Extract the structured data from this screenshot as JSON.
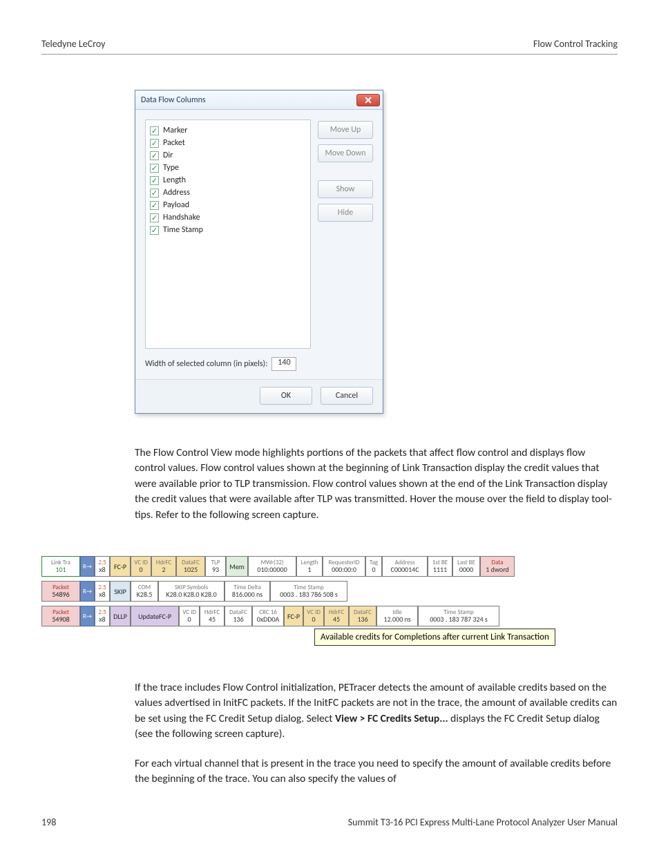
{
  "header": {
    "left": "Teledyne LeCroy",
    "right": "Flow Control Tracking"
  },
  "dialog": {
    "title": "Data Flow Columns",
    "columns": [
      "Marker",
      "Packet",
      "Dir",
      "Type",
      "Length",
      "Address",
      "Payload",
      "Handshake",
      "Time Stamp"
    ],
    "buttons": {
      "moveUp": "Move Up",
      "moveDown": "Move Down",
      "show": "Show",
      "hide": "Hide"
    },
    "widthLabel": "Width of selected column (in pixels):",
    "widthValue": "140",
    "ok": "OK",
    "cancel": "Cancel"
  },
  "para1": "The Flow Control View mode highlights portions of the packets that affect flow control and displays flow control values. Flow control values shown at the beginning of Link Transaction display the credit values that were available prior to TLP transmission. Flow control values shown at the end of the Link Transaction display the credit values that were available after TLP was transmitted. Hover the mouse over the field to display tool-tips. Refer to the following screen capture.",
  "trace": {
    "row1": {
      "a": {
        "top": "Link Tra",
        "bot": "101"
      },
      "dir": "R→",
      "speed": {
        "top": "2.5",
        "bot": "x8"
      },
      "tag": "FC-P",
      "cells": [
        {
          "h": "VC ID",
          "v": "0"
        },
        {
          "h": "HdrFC",
          "v": "2"
        },
        {
          "h": "DataFC",
          "v": "1025"
        },
        {
          "h": "TLP",
          "v": "93"
        }
      ],
      "mem": "Mem",
      "mwr": {
        "h": "MWr(32)",
        "v": "010:00000"
      },
      "len": {
        "h": "Length",
        "v": "1"
      },
      "req": {
        "h": "RequesterID",
        "v": "000:00:0"
      },
      "tag2": {
        "h": "Tag",
        "v": "0"
      },
      "addr": {
        "h": "Address",
        "v": "C000014C"
      },
      "be1": {
        "h": "1st BE",
        "v": "1111"
      },
      "be2": {
        "h": "Last BE",
        "v": "0000"
      },
      "data": {
        "h": "Data",
        "v": "1 dword"
      }
    },
    "row2": {
      "a": {
        "top": "Packet",
        "bot": "54896"
      },
      "dir": "R→",
      "speed": {
        "top": "2.5",
        "bot": "x8"
      },
      "tag": "SKIP",
      "cells": [
        {
          "h": "COM",
          "v": "K28.5"
        },
        {
          "h": "SKIP Symbols",
          "v": "K28.0 K28.0 K28.0"
        },
        {
          "h": "Time Delta",
          "v": "816.000 ns"
        },
        {
          "h": "Time Stamp",
          "v": "0003 . 183 786 508 s"
        }
      ]
    },
    "row3": {
      "a": {
        "top": "Packet",
        "bot": "54908"
      },
      "dir": "R→",
      "speed": {
        "top": "2.5",
        "bot": "x8"
      },
      "tag": "DLLP",
      "upd": "UpdateFC-P",
      "cells": [
        {
          "h": "VC ID",
          "v": "0"
        },
        {
          "h": "HdrFC",
          "v": "45"
        },
        {
          "h": "DataFC",
          "v": "136"
        },
        {
          "h": "CRC 16",
          "v": "0xDD0A"
        }
      ],
      "tag2": "FC-P",
      "cells2": [
        {
          "h": "VC ID",
          "v": "0"
        },
        {
          "h": "HdrFC",
          "v": "45"
        },
        {
          "h": "DataFC",
          "v": "136"
        },
        {
          "h": "Idle",
          "v": "12.000 ns"
        },
        {
          "h": "Time Stamp",
          "v": "0003 . 183 787 324 s"
        }
      ]
    },
    "tooltip": "Available credits for Completions after current Link Transaction"
  },
  "para2a": "If the trace includes Flow Control initialization, PETracer detects the amount of available credits based on the values advertised in InitFC packets. If the InitFC packets are not in the trace, the amount of available credits can be set using the FC Credit Setup dialog. Select ",
  "para2bold": "View > FC Credits Setup...",
  "para2b": " displays the FC Credit Setup dialog (see the following screen capture).",
  "para3": "For each virtual channel that is present in the trace you need to specify the amount of available credits before the beginning of the trace. You can also specify the values of",
  "footer": {
    "page": "198",
    "title": "Summit T3-16 PCI Express Multi-Lane Protocol Analyzer User Manual"
  }
}
